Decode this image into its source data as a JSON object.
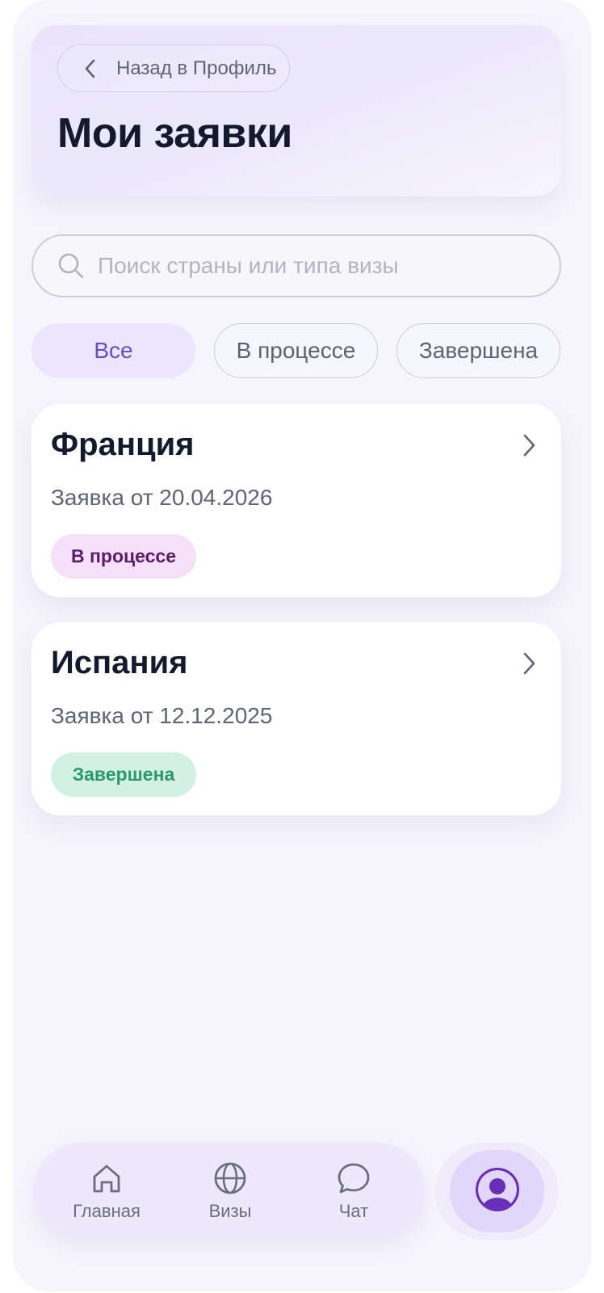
{
  "header": {
    "back_label": "Назад в Профиль",
    "title": "Мои заявки"
  },
  "search": {
    "placeholder": "Поиск страны или типа визы",
    "value": ""
  },
  "filters": [
    {
      "label": "Все",
      "active": true
    },
    {
      "label": "В процессе",
      "active": false
    },
    {
      "label": "Завершена",
      "active": false
    }
  ],
  "applications": [
    {
      "country": "Франция",
      "date": "Заявка от 20.04.2026",
      "status": "В процессе",
      "status_color": "#5a1d6a",
      "status_bg": "#f6e0f8"
    },
    {
      "country": "Испания",
      "date": "Заявка от 12.12.2025",
      "status": "Завершена",
      "status_color": "#2a9a6e",
      "status_bg": "#d2f0e4"
    }
  ],
  "nav": {
    "items": [
      {
        "label": "Главная",
        "icon": "home-icon"
      },
      {
        "label": "Визы",
        "icon": "globe-icon"
      },
      {
        "label": "Чат",
        "icon": "chat-icon"
      }
    ],
    "profile_icon": "user-avatar-icon"
  },
  "colors": {
    "accent": "#6a4cc4",
    "profile_accent": "#6a2fb8",
    "background": "#f6f5fc"
  }
}
